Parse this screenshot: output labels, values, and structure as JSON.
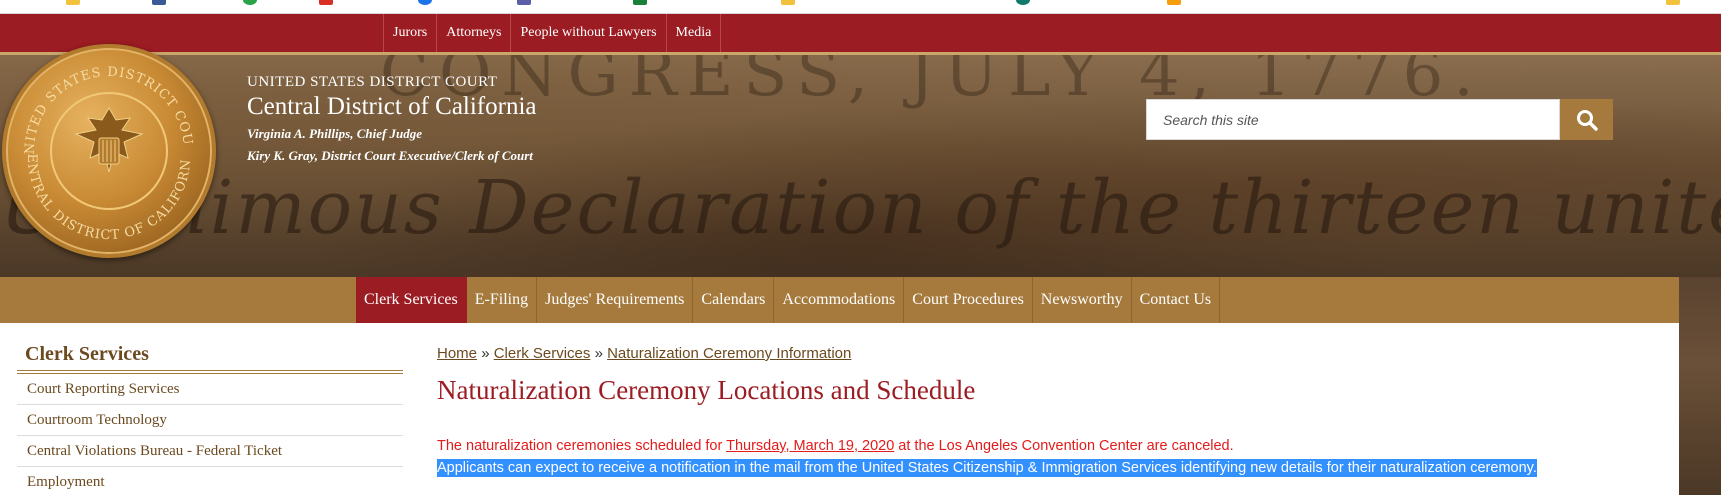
{
  "top_nav": {
    "items": [
      "Jurors",
      "Attorneys",
      "People without Lawyers",
      "Media"
    ]
  },
  "header": {
    "court_name": "UNITED STATES DISTRICT COURT",
    "district": "Central District of California",
    "chief_judge": "Virginia A. Phillips, Chief Judge",
    "clerk": "Kiry K. Gray, District Court Executive/Clerk of Court",
    "seal_icon": "court-seal-icon",
    "seal_top": "UNITED STATES DISTRICT COURT",
    "seal_bottom": "CENTRAL DISTRICT OF CALIFORNIA",
    "banner_text": "Unanimous Declaration of the thirteen united States of America",
    "banner_text_top": "CONGRESS, JULY 4, 1776."
  },
  "search": {
    "placeholder": "Search this site",
    "button_icon": "search-icon"
  },
  "main_nav": {
    "items": [
      "Clerk Services",
      "E-Filing",
      "Judges' Requirements",
      "Calendars",
      "Accommodations",
      "Court Procedures",
      "Newsworthy",
      "Contact Us"
    ],
    "active": "Clerk Services"
  },
  "sidebar": {
    "title": "Clerk Services",
    "items": [
      "Court Reporting Services",
      "Courtroom Technology",
      "Central Violations Bureau - Federal Ticket",
      "Employment"
    ]
  },
  "content": {
    "breadcrumb": {
      "home": "Home",
      "sep1": "»",
      "section": "Clerk Services",
      "sep2": "»",
      "current": "Naturalization Ceremony Information"
    },
    "title": "Naturalization Ceremony Locations and Schedule",
    "notice_before": "The naturalization ceremonies scheduled for ",
    "notice_date": "Thursday, March 19, 2020",
    "notice_after": " at the Los Angeles Convention Center are canceled.",
    "highlighted": "Applicants can expect to receive a notification in the mail from the United States Citizenship & Immigration Services identifying new details for their naturalization ceremony."
  },
  "colors": {
    "crimson": "#9b1c22",
    "gold": "#a57a3c",
    "notice_red": "#e31b1b",
    "selection_blue": "#3390ff"
  }
}
